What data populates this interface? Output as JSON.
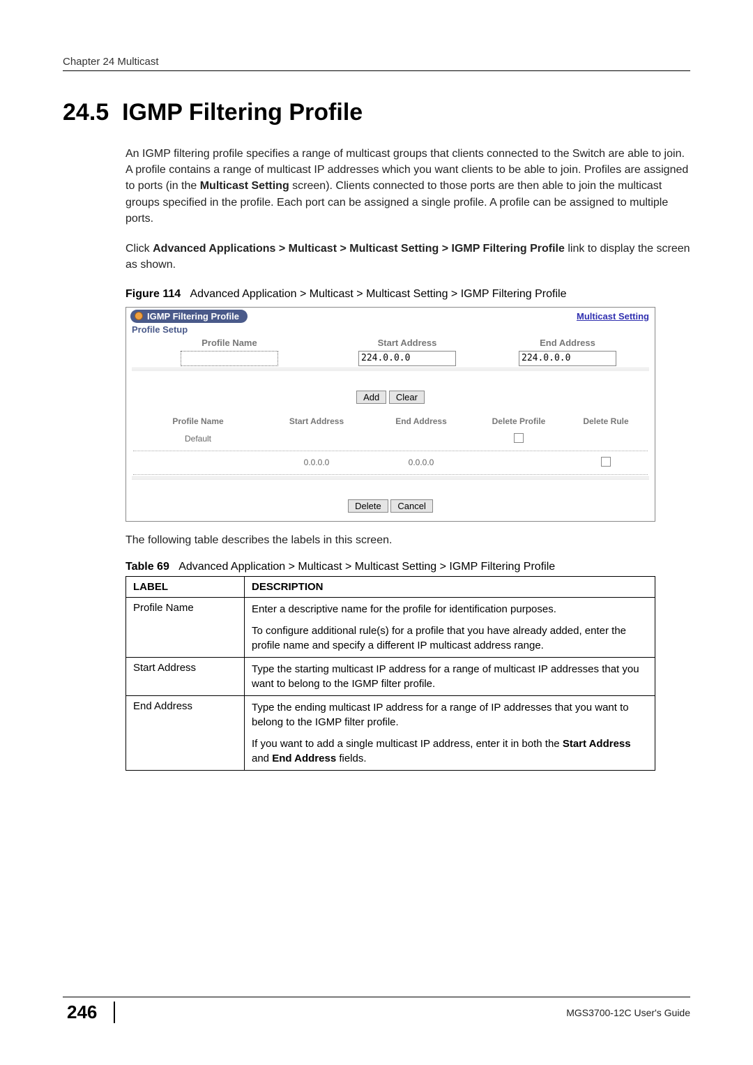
{
  "chapter_header": "Chapter 24 Multicast",
  "section_number": "24.5",
  "section_title": "IGMP Filtering Profile",
  "para1": "An IGMP filtering profile specifies a range of multicast groups that clients connected to the Switch are able to join. A profile contains a range of multicast IP addresses which you want clients to be able to join. Profiles are assigned to ports (in the ",
  "para1_bold": "Multicast Setting",
  "para1_cont": " screen). Clients connected to those ports are then able to join the multicast groups specified in the profile. Each port can be assigned a single profile. A profile can be assigned to multiple ports.",
  "para2_pre": "Click ",
  "para2_bold": "Advanced Applications > Multicast > Multicast Setting > IGMP Filtering Profile",
  "para2_post": " link to display the screen as shown.",
  "figure_label": "Figure 114",
  "figure_caption": "Advanced Application > Multicast > Multicast Setting > IGMP Filtering Profile",
  "screenshot": {
    "pill_title": "IGMP Filtering Profile",
    "top_link": "Multicast Setting",
    "section_label": "Profile Setup",
    "headers": {
      "profile_name": "Profile Name",
      "start_address": "Start Address",
      "end_address": "End Address"
    },
    "inputs": {
      "profile_name": "",
      "start_address": "224.0.0.0",
      "end_address": "224.0.0.0"
    },
    "buttons": {
      "add": "Add",
      "clear": "Clear",
      "delete": "Delete",
      "cancel": "Cancel"
    },
    "table_headers": {
      "profile_name": "Profile Name",
      "start_address": "Start Address",
      "end_address": "End Address",
      "delete_profile": "Delete Profile",
      "delete_rule": "Delete Rule"
    },
    "table_rows": {
      "row1_name": "Default",
      "row2_start": "0.0.0.0",
      "row2_end": "0.0.0.0"
    }
  },
  "post_figure": "The following table describes the labels in this screen.",
  "table_label": "Table 69",
  "table_caption": "Advanced Application > Multicast > Multicast Setting > IGMP Filtering Profile",
  "desc_table": {
    "th_label": "LABEL",
    "th_desc": "DESCRIPTION",
    "rows": [
      {
        "label": "Profile Name",
        "desc1": "Enter a descriptive name for the profile for identification purposes.",
        "desc2": "To configure additional rule(s) for a profile that you have already added, enter the profile name and specify a different IP multicast address range."
      },
      {
        "label": "Start Address",
        "desc1": "Type the starting multicast IP address for a range of multicast IP addresses that you want to belong to the IGMP filter profile."
      },
      {
        "label": "End Address",
        "desc1": "Type the ending multicast IP address for a range of IP addresses that you want to belong to the IGMP filter profile.",
        "desc2_pre": "If you want to add a single multicast IP address, enter it in both the ",
        "desc2_bold1": "Start Address",
        "desc2_mid": " and ",
        "desc2_bold2": "End Address",
        "desc2_post": " fields."
      }
    ]
  },
  "page_number": "246",
  "guide_name": "MGS3700-12C User's Guide"
}
